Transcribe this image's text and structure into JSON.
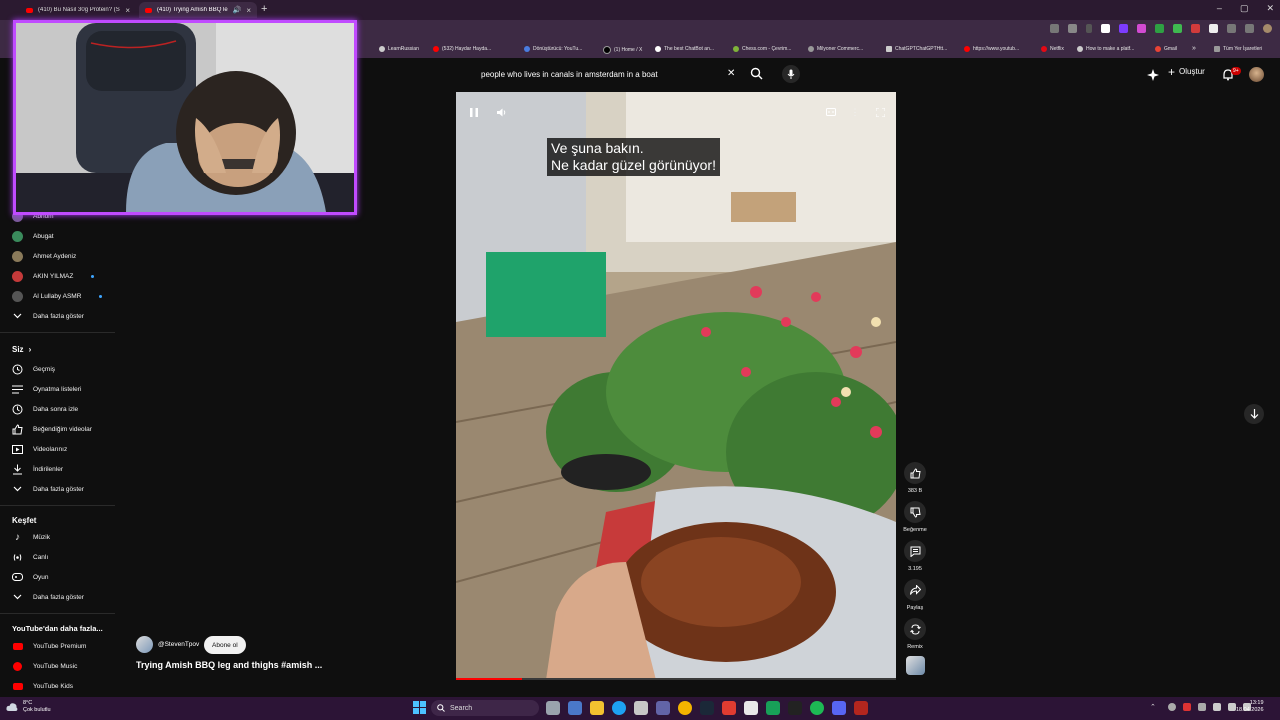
{
  "browser": {
    "tabs": [
      {
        "title": "(410) Bu Nasıl 30g Protein? (Sa..."
      },
      {
        "title": "(410) Trying Amish BBQ leg..."
      }
    ],
    "new_tab": "+",
    "bookmarks": [
      {
        "label": "LearnRussian"
      },
      {
        "label": "(532) Haydar Hayda..."
      },
      {
        "label": "Dönüştürücü: YouTu..."
      },
      {
        "label": "(1) Home / X"
      },
      {
        "label": "The best ChatBot an..."
      },
      {
        "label": "Chess.com - Çevrim..."
      },
      {
        "label": "Milyoner Commerc..."
      },
      {
        "label": "ChatGPTChatGPTHtt..."
      },
      {
        "label": "https://www.youtub..."
      },
      {
        "label": "Netflix"
      },
      {
        "label": "How to make a platf..."
      },
      {
        "label": "Gmail"
      },
      {
        "label": "»"
      },
      {
        "label": "Tüm Yer İşaretleri"
      }
    ]
  },
  "header": {
    "search_value": "people who lives in canals in amsterdam in a boat",
    "create_label": "Oluştur",
    "notif_count": "9+"
  },
  "sidebar": {
    "subscriptions": [
      {
        "label": "Abnom"
      },
      {
        "label": "Abugat"
      },
      {
        "label": "Ahmet Aydeniz"
      },
      {
        "label": "AKIN YILMAZ"
      },
      {
        "label": "Al Lullaby ASMR"
      }
    ],
    "show_more_1": "Daha fazla göster",
    "you_heading": "Siz",
    "you_items": [
      {
        "label": "Geçmiş"
      },
      {
        "label": "Oynatma listeleri"
      },
      {
        "label": "Daha sonra izle"
      },
      {
        "label": "Beğendiğim videolar"
      },
      {
        "label": "Videolarınız"
      },
      {
        "label": "İndirilenler"
      }
    ],
    "show_more_2": "Daha fazla göster",
    "explore_heading": "Keşfet",
    "explore_items": [
      {
        "label": "Müzik"
      },
      {
        "label": "Canlı"
      },
      {
        "label": "Oyun"
      }
    ],
    "show_more_3": "Daha fazla göster",
    "more_heading": "YouTube'dan daha fazla...",
    "more_items": [
      {
        "label": "YouTube Premium"
      },
      {
        "label": "YouTube Music"
      },
      {
        "label": "YouTube Kids"
      }
    ]
  },
  "video": {
    "caption_line1": "Ve şuna bakın.",
    "caption_line2": "Ne kadar güzel görünüyor!",
    "channel": "@StevenTpov",
    "subscribe_label": "Abone ol",
    "title": "Trying Amish BBQ leg and thighs #amish ...",
    "progress": 0.15
  },
  "actions": {
    "likes": "383 B",
    "dislike_label": "Beğenme",
    "comments": "3.195",
    "share_label": "Paylaş",
    "remix_label": "Remix"
  },
  "taskbar": {
    "weather_temp": "8°C",
    "weather_desc": "Çok bulutlu",
    "search_label": "Search",
    "time": "13:19",
    "date": "18.04.2026"
  },
  "colors": {
    "webcam_border": "#c04bff",
    "youtube_red": "#ff0000",
    "taskbar": "#2c1436"
  }
}
